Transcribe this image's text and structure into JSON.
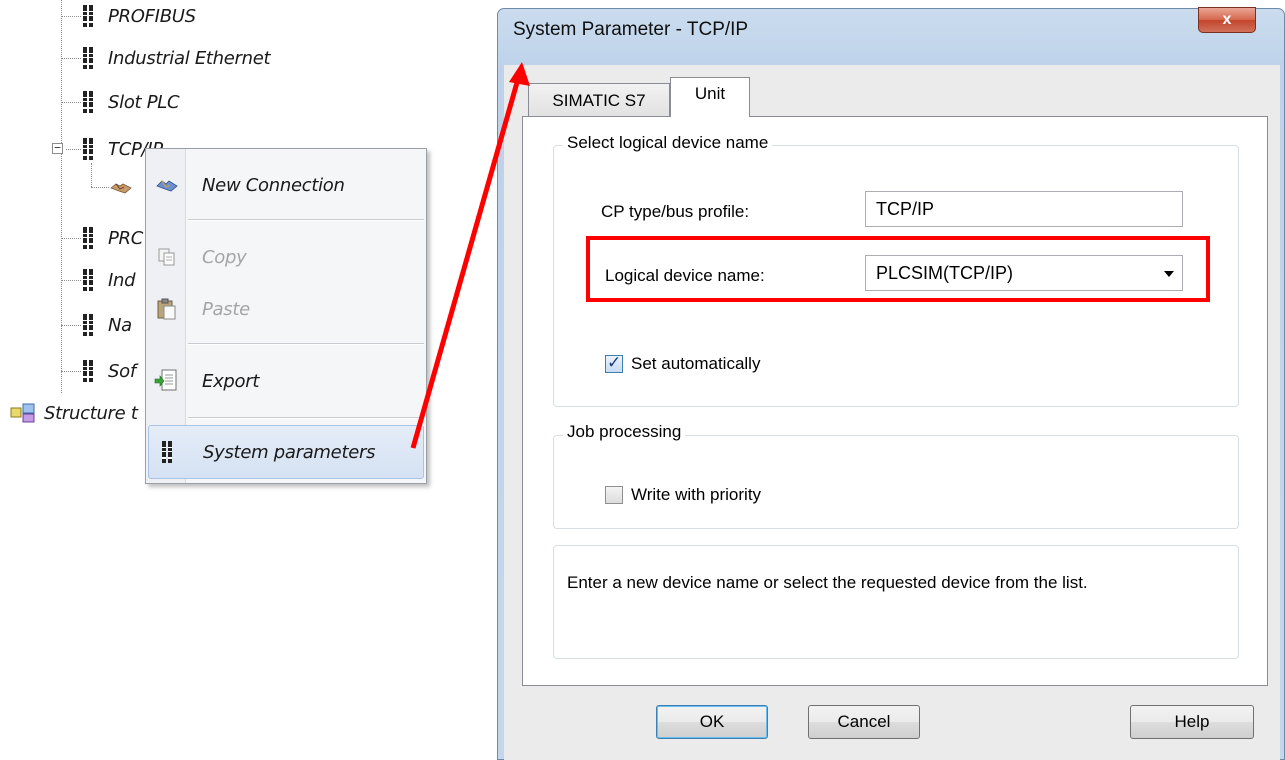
{
  "tree": {
    "items": [
      {
        "label": "PROFIBUS"
      },
      {
        "label": "Industrial Ethernet"
      },
      {
        "label": "Slot PLC"
      },
      {
        "label": "TCP/IP"
      },
      {
        "label": "PRC"
      },
      {
        "label": "Ind"
      },
      {
        "label": "Na"
      },
      {
        "label": "Sof"
      }
    ],
    "structure_label": "Structure t"
  },
  "context_menu": {
    "new_connection": "New Connection",
    "copy": "Copy",
    "paste": "Paste",
    "export": "Export",
    "system_parameters": "System parameters"
  },
  "dialog": {
    "title": "System Parameter - TCP/IP",
    "close_glyph": "x",
    "tabs": [
      {
        "label": "SIMATIC S7",
        "active": false
      },
      {
        "label": "Unit",
        "active": true
      }
    ],
    "group_device": {
      "title": "Select logical device name",
      "cp_label": "CP type/bus profile:",
      "cp_value": "TCP/IP",
      "device_label": "Logical device name:",
      "device_value": "PLCSIM(TCP/IP)",
      "auto_label": "Set automatically",
      "auto_checked": true
    },
    "group_job": {
      "title": "Job processing",
      "priority_label": "Write with priority",
      "priority_checked": false
    },
    "help_text": "Enter a new device name or select the requested device from the list.",
    "buttons": {
      "ok": "OK",
      "cancel": "Cancel",
      "help": "Help"
    }
  },
  "colors": {
    "annotation_red": "#ff0000",
    "title_bar": "#c3d7ec"
  }
}
